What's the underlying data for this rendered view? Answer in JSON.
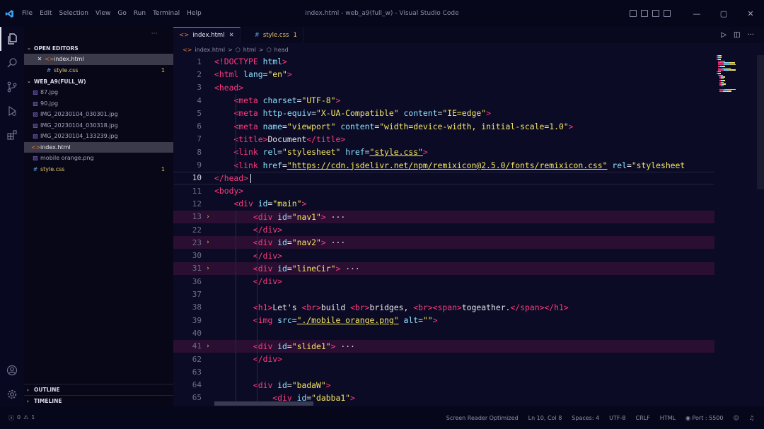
{
  "window": {
    "title": "index.html - web_a9(full_w) - Visual Studio Code",
    "menu": [
      "File",
      "Edit",
      "Selection",
      "View",
      "Go",
      "Run",
      "Terminal",
      "Help"
    ],
    "controls": {
      "minimize": "—",
      "maximize": "▢",
      "close": "✕"
    }
  },
  "sidebar": {
    "header_more": "···",
    "open_editors": {
      "title": "OPEN EDITORS",
      "items": [
        {
          "name": "index.html",
          "close": "✕",
          "icon": "html-icon"
        },
        {
          "name": "style.css",
          "badge": "1",
          "icon": "css-icon"
        }
      ]
    },
    "workspace": {
      "title": "WEB_A9(FULL_W)",
      "items": [
        {
          "name": "87.jpg",
          "icon": "image-icon"
        },
        {
          "name": "90.jpg",
          "icon": "image-icon"
        },
        {
          "name": "IMG_20230104_030301.jpg",
          "icon": "image-icon"
        },
        {
          "name": "IMG_20230104_030318.jpg",
          "icon": "image-icon"
        },
        {
          "name": "IMG_20230104_133239.jpg",
          "icon": "image-icon"
        },
        {
          "name": "index.html",
          "icon": "html-icon"
        },
        {
          "name": "mobile orange.png",
          "icon": "image-icon"
        },
        {
          "name": "style.css",
          "badge": "1",
          "icon": "css-icon"
        }
      ]
    },
    "outline": "OUTLINE",
    "timeline": "TIMELINE"
  },
  "tabs": [
    {
      "label": "index.html",
      "close": "✕",
      "active": true
    },
    {
      "label": "style.css",
      "badge": "1",
      "active": false
    }
  ],
  "breadcrumb": [
    "index.html",
    "html",
    "head"
  ],
  "breadcrumb_sep": ">",
  "editor": {
    "lines": [
      {
        "n": "1",
        "text": "<!DOCTYPE html>"
      },
      {
        "n": "2",
        "text": "<html lang=\"en\">"
      },
      {
        "n": "3",
        "text": "<head>"
      },
      {
        "n": "4",
        "text": "    <meta charset=\"UTF-8\">"
      },
      {
        "n": "5",
        "text": "    <meta http-equiv=\"X-UA-Compatible\" content=\"IE=edge\">"
      },
      {
        "n": "6",
        "text": "    <meta name=\"viewport\" content=\"width=device-width, initial-scale=1.0\">"
      },
      {
        "n": "7",
        "text": "    <title>Document</title>"
      },
      {
        "n": "8",
        "text": "    <link rel=\"stylesheet\" href=\"style.css\">"
      },
      {
        "n": "9",
        "text": "    <link href=\"https://cdn.jsdelivr.net/npm/remixicon@2.5.0/fonts/remixicon.css\" rel=\"stylesheet"
      },
      {
        "n": "10",
        "text": "</head>"
      },
      {
        "n": "11",
        "text": "<body>"
      },
      {
        "n": "12",
        "text": "    <div id=\"main\">"
      },
      {
        "n": "13",
        "text": "        <div id=\"nav1\"> ···"
      },
      {
        "n": "22",
        "text": "        </div>"
      },
      {
        "n": "23",
        "text": "        <div id=\"nav2\"> ···"
      },
      {
        "n": "30",
        "text": "        </div>"
      },
      {
        "n": "31",
        "text": "        <div id=\"lineCir\"> ···"
      },
      {
        "n": "36",
        "text": "        </div>"
      },
      {
        "n": "37",
        "text": ""
      },
      {
        "n": "38",
        "text": "        <h1>Let's <br>build <br>bridges, <br><span>togeather.</span></h1>"
      },
      {
        "n": "39",
        "text": "        <img src=\"./mobile orange.png\" alt=\"\">"
      },
      {
        "n": "40",
        "text": ""
      },
      {
        "n": "41",
        "text": "        <div id=\"slide1\"> ···"
      },
      {
        "n": "62",
        "text": "        </div>"
      },
      {
        "n": "63",
        "text": ""
      },
      {
        "n": "64",
        "text": "        <div id=\"badaW\">"
      },
      {
        "n": "65",
        "text": "            <div id=\"dabba1\">"
      }
    ],
    "folded_marker": "›"
  },
  "status": {
    "errors": "0",
    "warnings": "1",
    "items": [
      "Screen Reader Optimized",
      "Ln 10, Col 8",
      "Spaces: 4",
      "UTF-8",
      "CRLF",
      "HTML",
      "Port : 5500"
    ]
  },
  "colors": {
    "tag": "#ff3b7f",
    "attr": "#8fe3ff",
    "string": "#f4e563",
    "background": "#0b0b25"
  }
}
